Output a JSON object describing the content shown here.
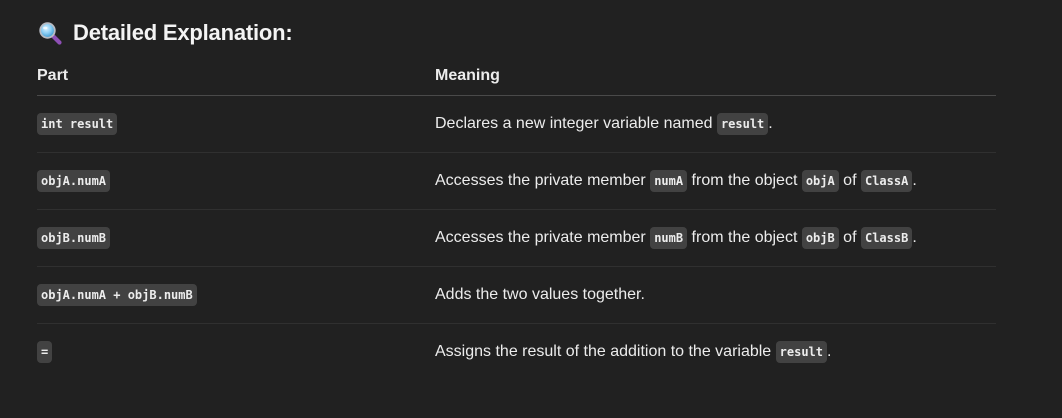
{
  "heading": {
    "icon": "magnifying-glass-icon",
    "text": "Detailed Explanation:"
  },
  "table": {
    "headers": [
      "Part",
      "Meaning"
    ],
    "rows": [
      {
        "part": "int result",
        "meaning": [
          {
            "t": "Declares a new integer variable named "
          },
          {
            "c": "result"
          },
          {
            "t": "."
          }
        ]
      },
      {
        "part": "objA.numA",
        "meaning": [
          {
            "t": "Accesses the private member "
          },
          {
            "c": "numA"
          },
          {
            "t": " from the object "
          },
          {
            "c": "objA"
          },
          {
            "t": " of "
          },
          {
            "c": "ClassA"
          },
          {
            "t": "."
          }
        ]
      },
      {
        "part": "objB.numB",
        "meaning": [
          {
            "t": "Accesses the private member "
          },
          {
            "c": "numB"
          },
          {
            "t": " from the object "
          },
          {
            "c": "objB"
          },
          {
            "t": " of "
          },
          {
            "c": "ClassB"
          },
          {
            "t": "."
          }
        ]
      },
      {
        "part": "objA.numA + objB.numB",
        "meaning": [
          {
            "t": "Adds the two values together."
          }
        ]
      },
      {
        "part": "=",
        "meaning": [
          {
            "t": "Assigns the result of the addition to the variable "
          },
          {
            "c": "result"
          },
          {
            "t": "."
          }
        ]
      }
    ]
  }
}
